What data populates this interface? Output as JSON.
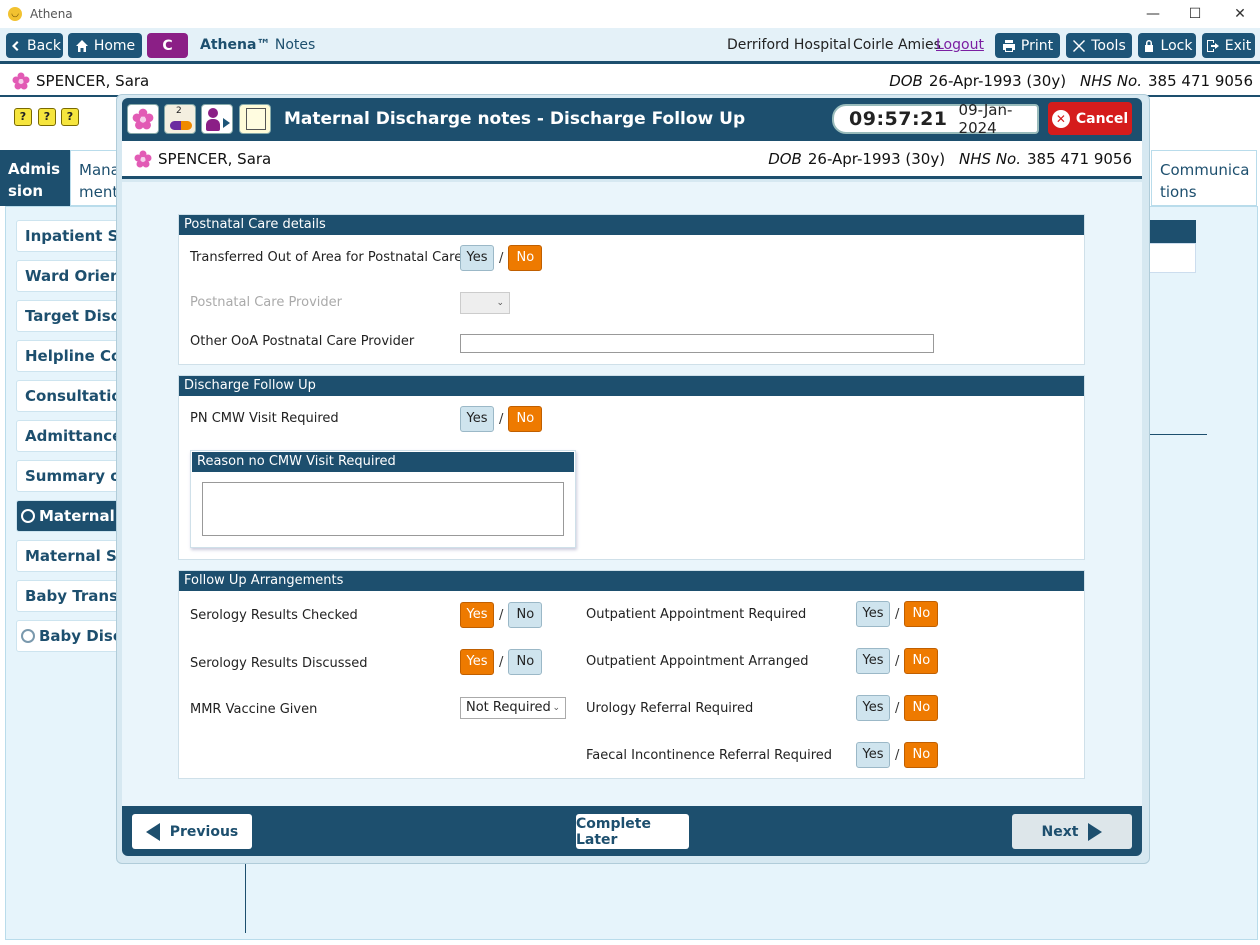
{
  "window": {
    "title": "Athena",
    "minimize": "—",
    "maximize": "☐",
    "close": "✕"
  },
  "toolbar": {
    "back": "Back",
    "home": "Home",
    "c_label": "C",
    "brand": "Athena™",
    "brand_sub": "Notes",
    "hospital": "Derriford Hospital",
    "user": "Coirle Amies",
    "logout": "Logout",
    "print": "Print",
    "tools": "Tools",
    "lock": "Lock",
    "exit": "Exit"
  },
  "patient": {
    "name": "SPENCER, Sara",
    "dob_label": "DOB",
    "dob": "26-Apr-1993 (30y)",
    "nhs_label": "NHS No.",
    "nhs": "385 471 9056"
  },
  "status_icons": [
    "?",
    "?",
    "?"
  ],
  "tabs": {
    "admission": "Admis\nsion",
    "management": "Mana\nment",
    "communications": "Communica\ntions"
  },
  "sidebar": {
    "items": [
      "Inpatient Stay",
      "Ward Orientat",
      "Target Discha",
      "Helpline Cont",
      "Consultation I",
      "Admittance N",
      "Summary of P",
      "Maternal Di",
      "Maternal Self",
      "Baby Transfer",
      "Baby Discha"
    ]
  },
  "modal": {
    "title": "Maternal Discharge notes - Discharge Follow Up",
    "time": "09:57:21",
    "date": "09-Jan-2024",
    "cancel": "Cancel",
    "tray_badge": "2",
    "sections": {
      "postnatal": {
        "header": "Postnatal Care details",
        "transferred": "Transferred Out of Area for Postnatal Care",
        "provider": "Postnatal Care Provider",
        "other": "Other OoA Postnatal Care Provider"
      },
      "discharge": {
        "header": "Discharge Follow Up",
        "cmw": "PN CMW Visit Required",
        "reason_header": "Reason no CMW Visit Required"
      },
      "followup": {
        "header": "Follow Up Arrangements",
        "serology_checked": "Serology Results Checked",
        "serology_discussed": "Serology Results Discussed",
        "mmr": "MMR Vaccine Given",
        "mmr_value": "Not Required",
        "op_required": "Outpatient Appointment Required",
        "op_arranged": "Outpatient Appointment Arranged",
        "urology": "Urology Referral Required",
        "faecal": "Faecal Incontinence Referral Required"
      }
    },
    "yes": "Yes",
    "no": "No",
    "slash": "/",
    "footer": {
      "previous": "Previous",
      "complete_later": "Complete Later",
      "next": "Next"
    }
  },
  "colors": {
    "brand": "#1d4f6e",
    "selected": "#ee7a00",
    "cancel": "#d51c1c"
  }
}
